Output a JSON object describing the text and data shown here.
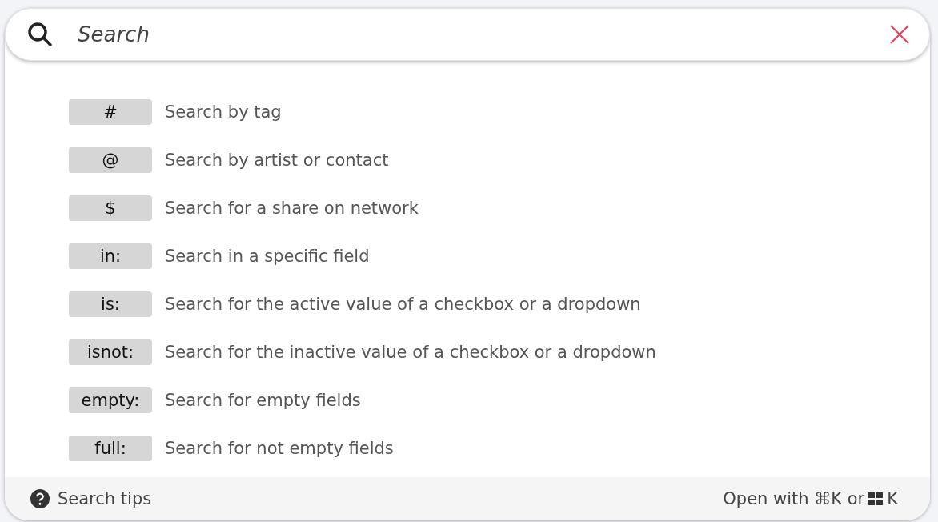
{
  "search": {
    "placeholder": "Search"
  },
  "tips": [
    {
      "key": "#",
      "description": "Search by tag"
    },
    {
      "key": "@",
      "description": "Search by artist or contact"
    },
    {
      "key": "$",
      "description": "Search for a share on network"
    },
    {
      "key": "in:",
      "description": "Search in a specific field"
    },
    {
      "key": "is:",
      "description": "Search for the active value of a checkbox or a dropdown"
    },
    {
      "key": "isnot:",
      "description": "Search for the inactive value of a checkbox or a dropdown"
    },
    {
      "key": "empty:",
      "description": "Search for empty fields"
    },
    {
      "key": "full:",
      "description": "Search for not empty fields"
    }
  ],
  "footer": {
    "help_link": "Search tips",
    "shortcut_text": "Open with ⌘K or",
    "shortcut_key": "K"
  }
}
